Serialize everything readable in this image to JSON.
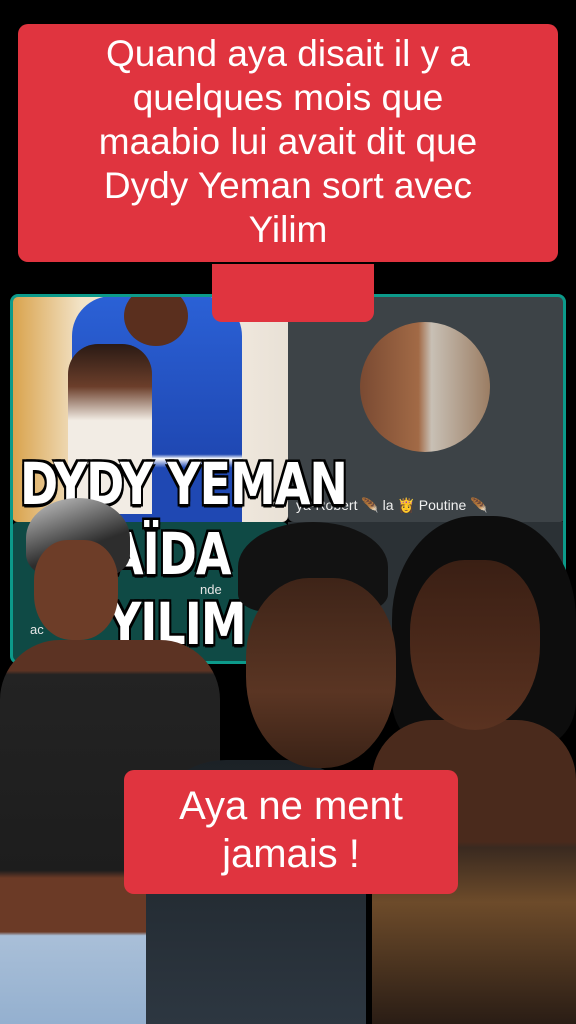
{
  "captions": {
    "top_lines": [
      "Quand aya disait il y a",
      "quelques mois que",
      "maabio lui avait dit que",
      "Dydy Yeman sort avec",
      "Yilim"
    ],
    "bottom_lines": [
      "Aya ne ment",
      "jamais !"
    ]
  },
  "overlay_text": [
    "DYDY YEMAN",
    "AÏDA",
    "YILIM"
  ],
  "video_labels": {
    "name_tag": "ya-Robert 🪶 la 👸 Poutine 🪶",
    "side_text_1": "nde",
    "side_text_2": "ac"
  },
  "colors": {
    "caption_bg": "#e0343f",
    "frame_border": "#0c9a8a"
  }
}
